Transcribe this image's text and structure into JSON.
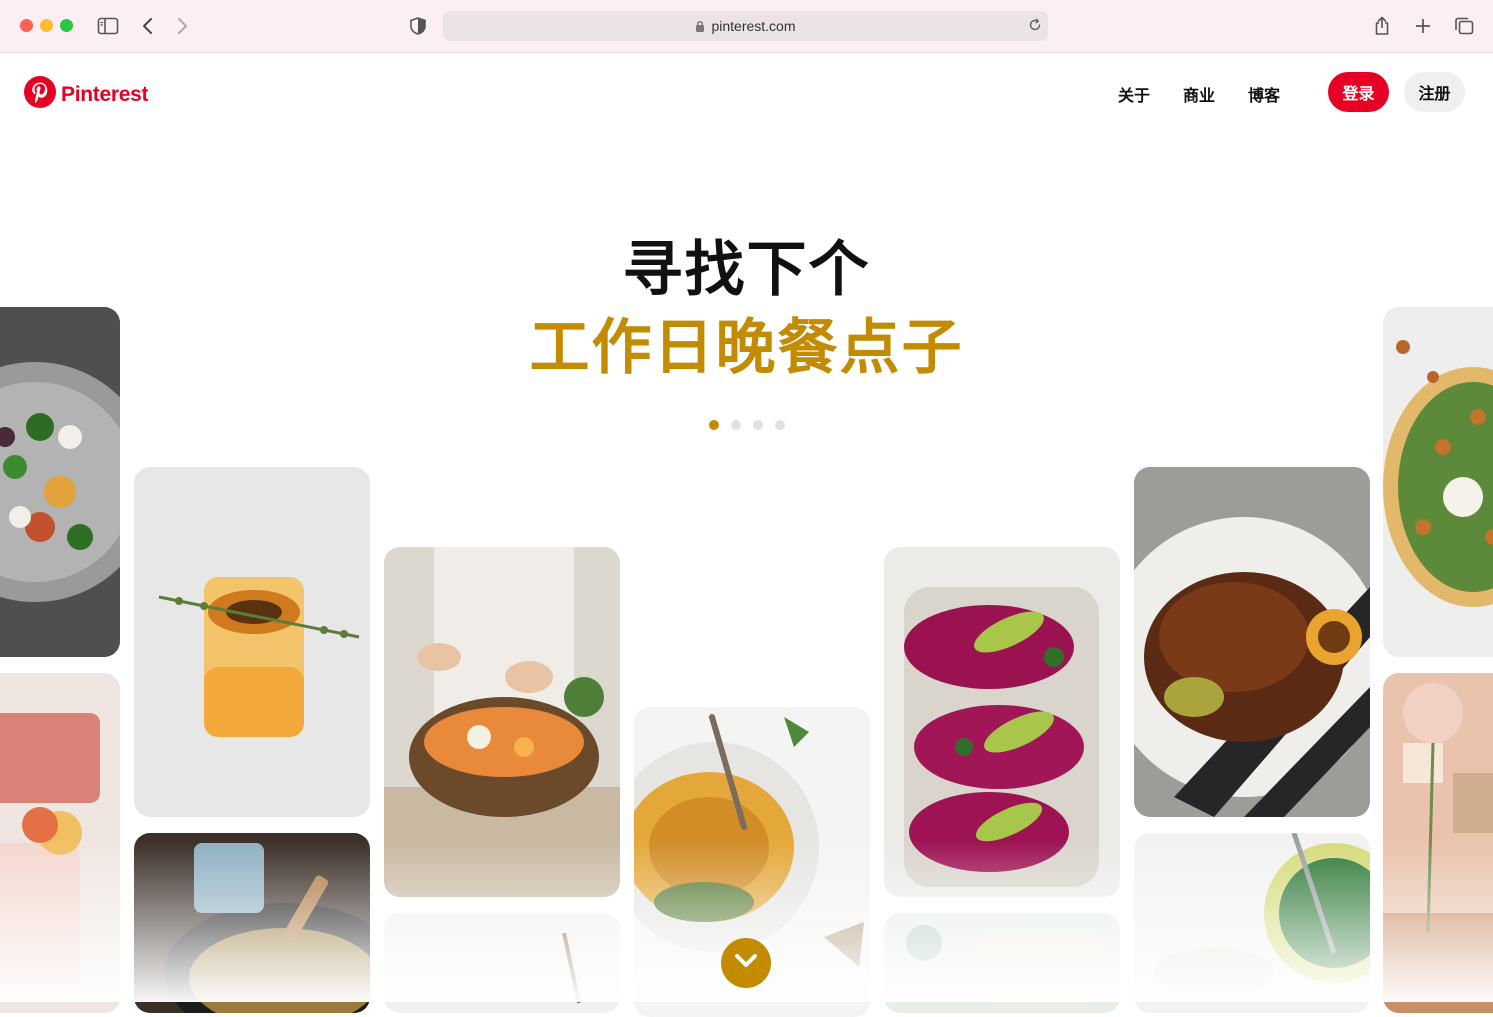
{
  "browser": {
    "url": "pinterest.com",
    "icons": [
      "sidebar-icon",
      "back-icon",
      "forward-icon",
      "shield-icon",
      "lock-icon",
      "reload-icon",
      "share-icon",
      "new-tab-icon",
      "tabs-overview-icon"
    ]
  },
  "header": {
    "logo_text": "Pinterest",
    "nav": [
      "关于",
      "商业",
      "博客"
    ],
    "login_label": "登录",
    "signup_label": "注册"
  },
  "hero": {
    "line1": "寻找下个",
    "line2": "工作日晚餐点子",
    "carousel_total": 4,
    "carousel_active": 1
  },
  "colors": {
    "brand_red": "#e60023",
    "accent_gold": "#c28b00"
  },
  "photos": [
    "beet-salad",
    "drink-in-glass",
    "hands-garnishing-bowl",
    "hummus-plate",
    "avocado-beet-toasts",
    "roast-chicken",
    "chickpea-flatbread",
    "pink-drink",
    "skillet-dish",
    "white-plate",
    "herb-wrap",
    "green-peas-bowl",
    "pink-cafe-interior"
  ]
}
